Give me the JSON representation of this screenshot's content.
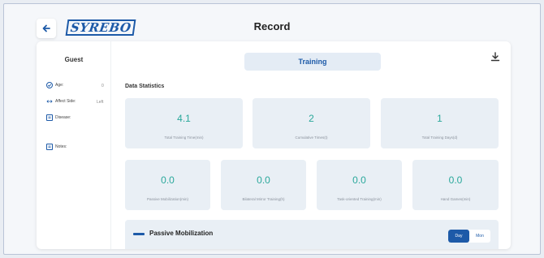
{
  "header": {
    "title": "Record",
    "logo_text": "SYREBO",
    "back_icon": "arrow-left-icon"
  },
  "sidebar": {
    "user_name": "Guest",
    "fields": [
      {
        "label": "Age:",
        "value": "0",
        "icon": "age-icon"
      },
      {
        "label": "Affect Side:",
        "value": "Left",
        "icon": "affect-side-icon"
      },
      {
        "label": "Disease:",
        "value": "",
        "icon": "disease-icon"
      },
      {
        "label": "Notes:",
        "value": "",
        "icon": "notes-icon"
      }
    ]
  },
  "main": {
    "active_tab": "Training",
    "download_icon": "download-icon",
    "section_title": "Data Statistics",
    "top_stats": [
      {
        "value": "4.1",
        "label": "Total Training Time(min)"
      },
      {
        "value": "2",
        "label": "Cumulative Times(t)"
      },
      {
        "value": "1",
        "label": "Total Training Days(d)"
      }
    ],
    "bottom_stats": [
      {
        "value": "0.0",
        "label": "Passive Mobilization(min)"
      },
      {
        "value": "0.0",
        "label": "Bilateral Mirror Training(h)"
      },
      {
        "value": "0.0",
        "label": "Task-oriented Training(min)"
      },
      {
        "value": "0.0",
        "label": "Hand Games(min)"
      }
    ],
    "panel": {
      "title": "Passive Mobilization",
      "toggle": {
        "selected": "Day",
        "other": "Mon"
      }
    }
  },
  "colors": {
    "accent": "#1d5aa8",
    "value_teal": "#2aa89b",
    "card_bg": "#e9eff5"
  }
}
